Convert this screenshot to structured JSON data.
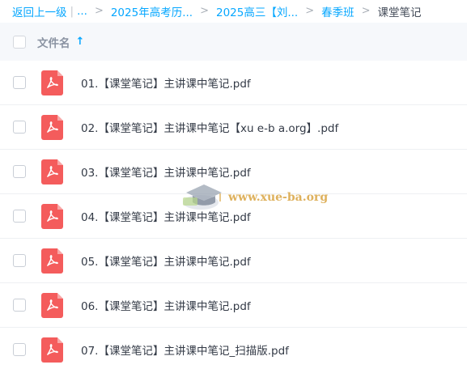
{
  "breadcrumb": {
    "back": "返回上一级",
    "pipe": "|",
    "ellipsis": "...",
    "separator": ">",
    "items": [
      "2025年高考历...",
      "2025高三【刘...",
      "春季班"
    ],
    "current": "课堂笔记"
  },
  "list_header": {
    "column_label": "文件名",
    "sort_indicator": "↑"
  },
  "files": [
    {
      "name": "01.【课堂笔记】主讲课中笔记.pdf",
      "icon": "pdf-icon"
    },
    {
      "name": "02.【课堂笔记】主讲课中笔记【xu e-b a.org】.pdf",
      "icon": "pdf-icon"
    },
    {
      "name": "03.【课堂笔记】主讲课中笔记.pdf",
      "icon": "pdf-icon"
    },
    {
      "name": "04.【课堂笔记】主讲课中笔记.pdf",
      "icon": "pdf-icon"
    },
    {
      "name": "05.【课堂笔记】主讲课中笔记.pdf",
      "icon": "pdf-icon"
    },
    {
      "name": "06.【课堂笔记】主讲课中笔记.pdf",
      "icon": "pdf-icon"
    },
    {
      "name": "07.【课堂笔记】主讲课中笔记_扫描版.pdf",
      "icon": "pdf-icon"
    }
  ],
  "watermark": {
    "text": "www.xue-ba.org"
  },
  "colors": {
    "link": "#06a7ff",
    "pdf_red": "#f45c5c",
    "header_bg": "#f6f8fb",
    "text": "#333a46"
  }
}
